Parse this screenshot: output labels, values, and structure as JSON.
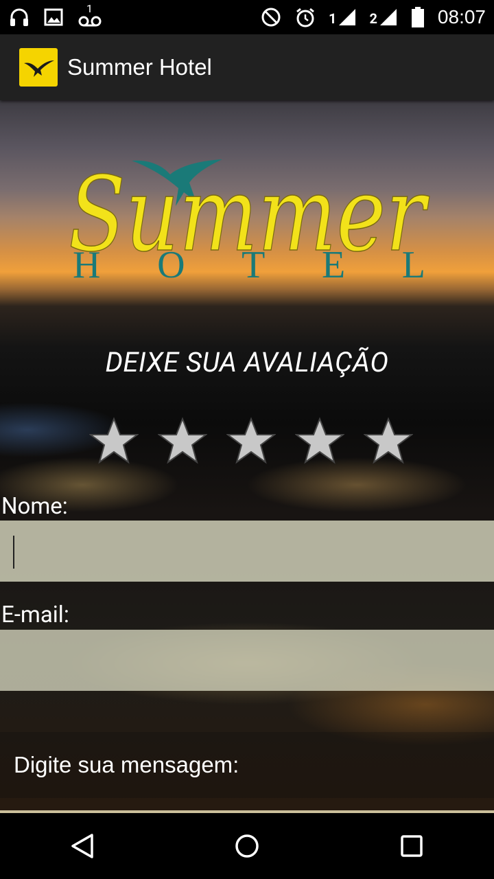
{
  "status_bar": {
    "time": "08:07",
    "left_icons": [
      "headphones-icon",
      "image-icon",
      "voicemail-icon"
    ],
    "voicemail_count": "1",
    "right_icons": [
      "do-not-disturb-icon",
      "alarm-icon",
      "signal-sim1-icon",
      "signal-sim2-icon",
      "battery-icon"
    ],
    "sim1_label": "1",
    "sim2_label": "2"
  },
  "app_bar": {
    "title": "Summer Hotel",
    "icon": "bird-logo-icon"
  },
  "logo": {
    "script_text": "Summer",
    "sub_text": "HOTEL"
  },
  "review": {
    "heading": "DEIXE SUA AVALIAÇÃO",
    "rating": 0,
    "max_rating": 5
  },
  "form": {
    "name_label": "Nome:",
    "name_value": "",
    "email_label": "E-mail:",
    "email_value": "",
    "message_placeholder": "Digite sua mensagem:"
  },
  "colors": {
    "app_bar": "#212121",
    "app_icon_bg": "#f5d400",
    "logo_yellow": "#f2e21a",
    "logo_teal": "#1a7a78",
    "star_fill": "#c8c8c8"
  },
  "nav_bar": {
    "icons": [
      "back-icon",
      "home-icon",
      "recents-icon"
    ]
  }
}
